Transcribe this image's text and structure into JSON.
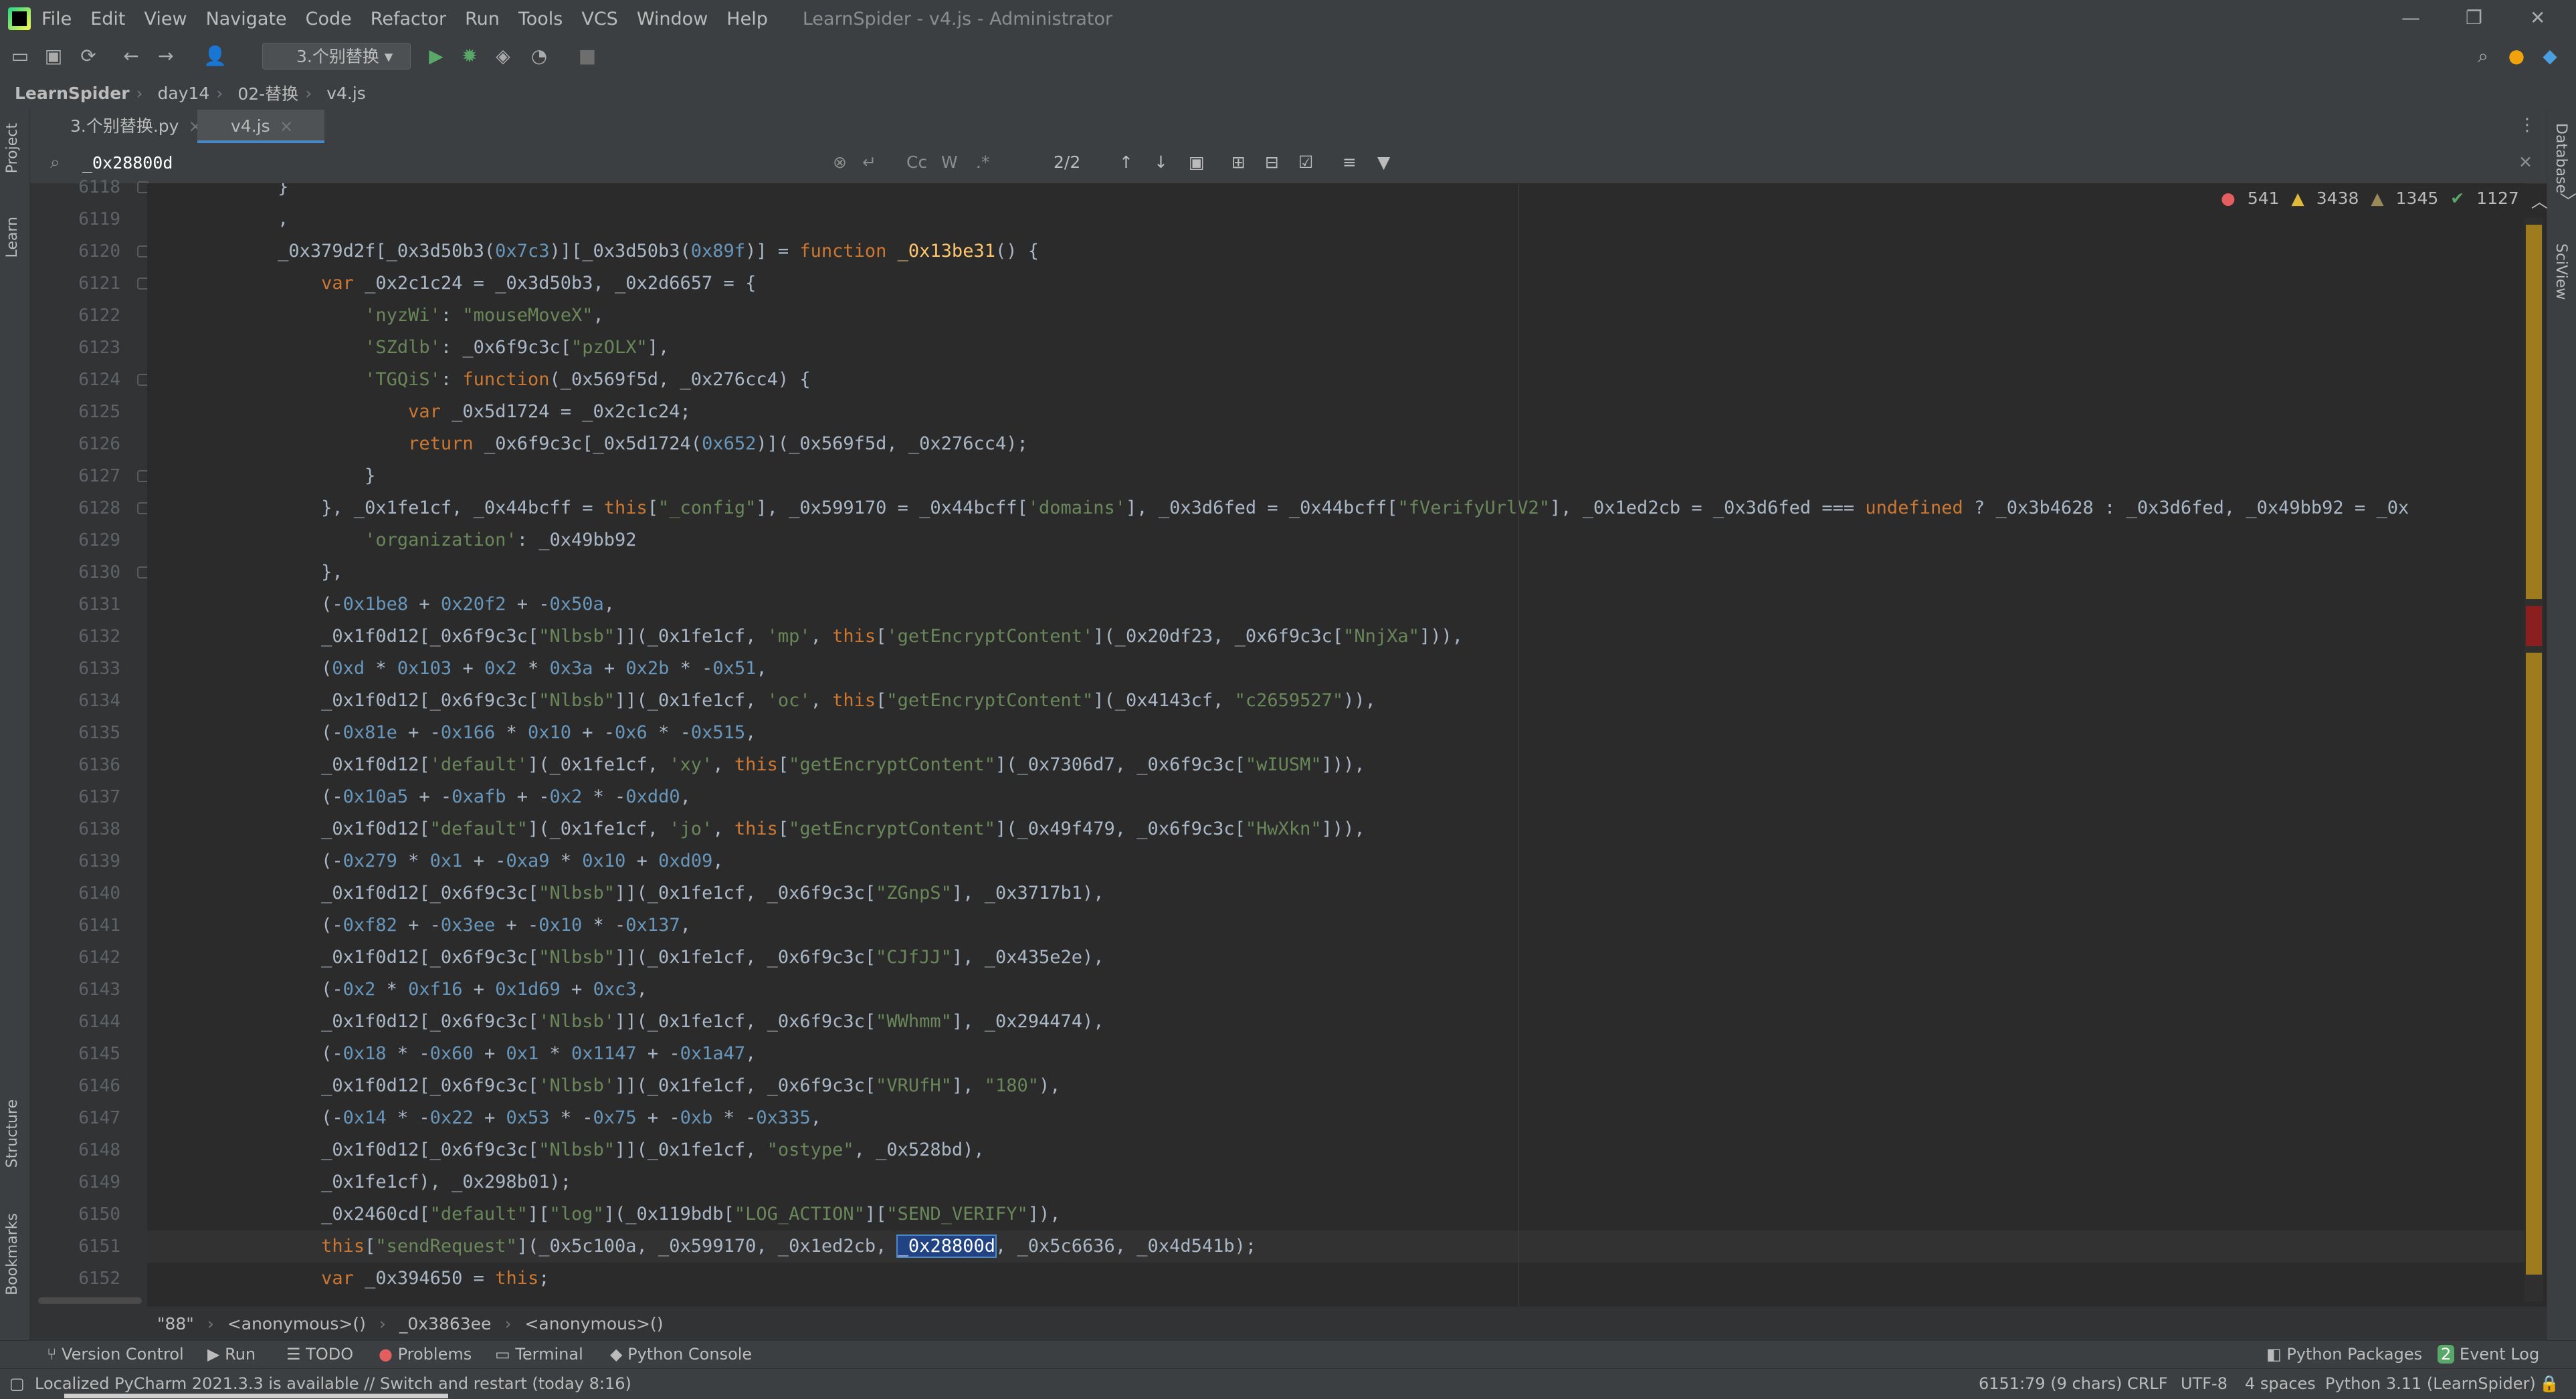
{
  "window": {
    "title": "LearnSpider - v4.js - Administrator",
    "menu": [
      "File",
      "Edit",
      "View",
      "Navigate",
      "Code",
      "Refactor",
      "Run",
      "Tools",
      "VCS",
      "Window",
      "Help"
    ]
  },
  "toolbar": {
    "run_config": "3.个别替换"
  },
  "breadcrumb": [
    "LearnSpider",
    "day14",
    "02-替换",
    "v4.js"
  ],
  "sidebar_left": [
    "Project",
    "Learn",
    "Structure",
    "Bookmarks"
  ],
  "sidebar_right": [
    "Database",
    "SciView"
  ],
  "tabs": [
    {
      "label": "3.个别替换.py",
      "active": false
    },
    {
      "label": "v4.js",
      "active": true
    }
  ],
  "find": {
    "query": "_0x28800d",
    "match_count": "2/2",
    "options": [
      "Cc",
      "W",
      ".*"
    ]
  },
  "inspections": {
    "errors": "541",
    "warnings": "3438",
    "weak_warnings": "1345",
    "typos": "1127"
  },
  "editor": {
    "lines": [
      {
        "num": "6118",
        "code": "            }"
      },
      {
        "num": "6119",
        "code": "            ,"
      },
      {
        "num": "6120",
        "code": "            _0x379d2f[_0x3d50b3(0x7c3)][_0x3d50b3(0x89f)] = function _0x13be31() {"
      },
      {
        "num": "6121",
        "code": "                var _0x2c1c24 = _0x3d50b3, _0x2d6657 = {"
      },
      {
        "num": "6122",
        "code": "                    'nyzWi': \"mouseMoveX\","
      },
      {
        "num": "6123",
        "code": "                    'SZdlb': _0x6f9c3c[\"pzOLX\"],"
      },
      {
        "num": "6124",
        "code": "                    'TGQiS': function(_0x569f5d, _0x276cc4) {"
      },
      {
        "num": "6125",
        "code": "                        var _0x5d1724 = _0x2c1c24;"
      },
      {
        "num": "6126",
        "code": "                        return _0x6f9c3c[_0x5d1724(0x652)](_0x569f5d, _0x276cc4);"
      },
      {
        "num": "6127",
        "code": "                    }"
      },
      {
        "num": "6128",
        "code": "                }, _0x1fe1cf, _0x44bcff = this[\"_config\"], _0x599170 = _0x44bcff['domains'], _0x3d6fed = _0x44bcff[\"fVerifyUrlV2\"], _0x1ed2cb = _0x3d6fed === undefined ? _0x3b4628 : _0x3d6fed, _0x49bb92 = _0x"
      },
      {
        "num": "6129",
        "code": "                    'organization': _0x49bb92"
      },
      {
        "num": "6130",
        "code": "                },"
      },
      {
        "num": "6131",
        "code": "                (-0x1be8 + 0x20f2 + -0x50a,"
      },
      {
        "num": "6132",
        "code": "                _0x1f0d12[_0x6f9c3c[\"Nlbsb\"]](_0x1fe1cf, 'mp', this['getEncryptContent'](_0x20df23, _0x6f9c3c[\"NnjXa\"])),"
      },
      {
        "num": "6133",
        "code": "                (0xd * 0x103 + 0x2 * 0x3a + 0x2b * -0x51,"
      },
      {
        "num": "6134",
        "code": "                _0x1f0d12[_0x6f9c3c[\"Nlbsb\"]](_0x1fe1cf, 'oc', this[\"getEncryptContent\"](_0x4143cf, \"c2659527\")),"
      },
      {
        "num": "6135",
        "code": "                (-0x81e + -0x166 * 0x10 + -0x6 * -0x515,"
      },
      {
        "num": "6136",
        "code": "                _0x1f0d12['default'](_0x1fe1cf, 'xy', this[\"getEncryptContent\"](_0x7306d7, _0x6f9c3c[\"wIUSM\"])),"
      },
      {
        "num": "6137",
        "code": "                (-0x10a5 + -0xafb + -0x2 * -0xdd0,"
      },
      {
        "num": "6138",
        "code": "                _0x1f0d12[\"default\"](_0x1fe1cf, 'jo', this[\"getEncryptContent\"](_0x49f479, _0x6f9c3c[\"HwXkn\"])),"
      },
      {
        "num": "6139",
        "code": "                (-0x279 * 0x1 + -0xa9 * 0x10 + 0xd09,"
      },
      {
        "num": "6140",
        "code": "                _0x1f0d12[_0x6f9c3c[\"Nlbsb\"]](_0x1fe1cf, _0x6f9c3c[\"ZGnpS\"], _0x3717b1),"
      },
      {
        "num": "6141",
        "code": "                (-0xf82 + -0x3ee + -0x10 * -0x137,"
      },
      {
        "num": "6142",
        "code": "                _0x1f0d12[_0x6f9c3c[\"Nlbsb\"]](_0x1fe1cf, _0x6f9c3c[\"CJfJJ\"], _0x435e2e),"
      },
      {
        "num": "6143",
        "code": "                (-0x2 * 0xf16 + 0x1d69 + 0xc3,"
      },
      {
        "num": "6144",
        "code": "                _0x1f0d12[_0x6f9c3c['Nlbsb']](_0x1fe1cf, _0x6f9c3c[\"WWhmm\"], _0x294474),"
      },
      {
        "num": "6145",
        "code": "                (-0x18 * -0x60 + 0x1 * 0x1147 + -0x1a47,"
      },
      {
        "num": "6146",
        "code": "                _0x1f0d12[_0x6f9c3c['Nlbsb']](_0x1fe1cf, _0x6f9c3c[\"VRUfH\"], \"180\"),"
      },
      {
        "num": "6147",
        "code": "                (-0x14 * -0x22 + 0x53 * -0x75 + -0xb * -0x335,"
      },
      {
        "num": "6148",
        "code": "                _0x1f0d12[_0x6f9c3c[\"Nlbsb\"]](_0x1fe1cf, \"ostype\", _0x528bd),"
      },
      {
        "num": "6149",
        "code": "                _0x1fe1cf), _0x298b01);"
      },
      {
        "num": "6150",
        "code": "                _0x2460cd[\"default\"][\"log\"](_0x119bdb[\"LOG_ACTION\"][\"SEND_VERIFY\"]),"
      },
      {
        "num": "6151",
        "code": "                this[\"sendRequest\"](_0x5c100a, _0x599170, _0x1ed2cb, _0x28800d, _0x5c6636, _0x4d541b);"
      },
      {
        "num": "6152",
        "code": "                var _0x394650 = this;"
      }
    ]
  },
  "editor_breadcrumb": [
    "\"88\"",
    "<anonymous>()",
    "_0x3863ee",
    "<anonymous>()"
  ],
  "tool_windows": [
    "Version Control",
    "Run",
    "TODO",
    "Problems",
    "Terminal",
    "Python Console",
    "Python Packages",
    "Event Log"
  ],
  "event_log_count": "2",
  "status": {
    "message": "Localized PyCharm 2021.3.3 is available // Switch and restart (today 8:16)",
    "position": "6151:79 (9 chars)",
    "line_sep": "CRLF",
    "encoding": "UTF-8",
    "indent": "4 spaces",
    "interpreter": "Python 3.11 (LearnSpider)"
  }
}
